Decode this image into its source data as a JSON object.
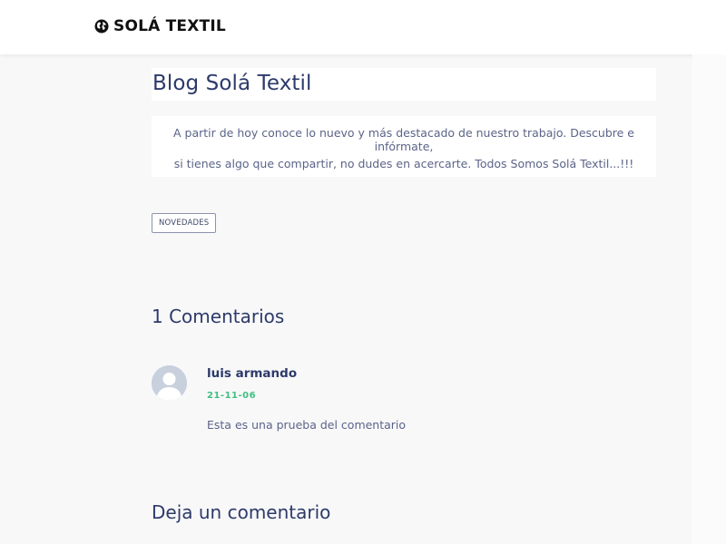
{
  "header": {
    "brand": "SOLÁ TEXTIL",
    "brand_icon": "globe-icon"
  },
  "post": {
    "title": "Blog Solá Textil",
    "intro_line1": "A partir de hoy conoce lo nuevo y más destacado de nuestro trabajo. Descubre e infórmate,",
    "intro_line2": "si tienes algo que compartir, no dudes en acercarte. Todos Somos Solá Textil...!!!",
    "tag": "NOVEDADES"
  },
  "comments": {
    "heading": "1 Comentarios",
    "items": [
      {
        "author": "luis armando",
        "date": "21-11-06",
        "text": "Esta es una prueba del comentario",
        "avatar_icon": "user-avatar-icon"
      }
    ]
  },
  "reply": {
    "heading": "Deja un comentario"
  },
  "colors": {
    "heading": "#2d3a6a",
    "body_text": "#5b6488",
    "date_green": "#3fbf7f",
    "background": "#f8f8f9"
  }
}
